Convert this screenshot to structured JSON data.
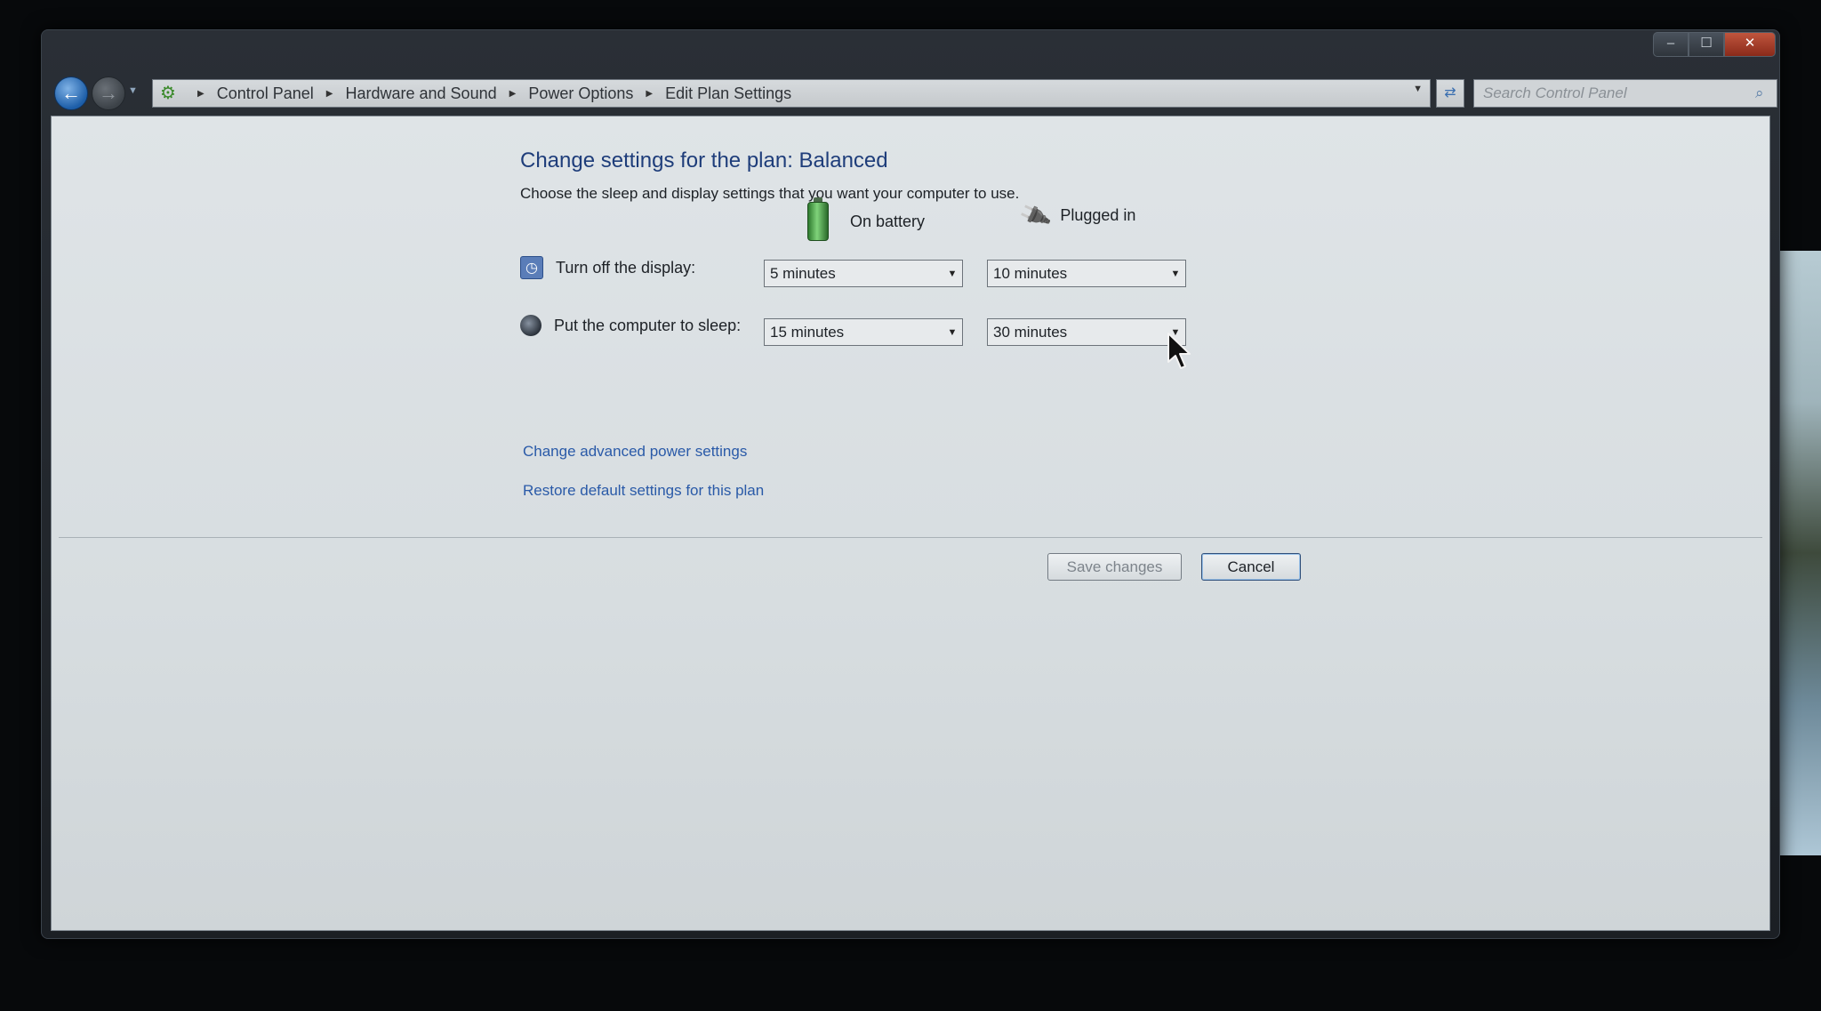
{
  "window": {
    "caption_buttons": {
      "minimize": "–",
      "maximize": "☐",
      "close": "✕"
    }
  },
  "navigation": {
    "back_icon": "back-arrow-icon",
    "forward_icon": "forward-arrow-icon",
    "breadcrumbs": [
      "Control Panel",
      "Hardware and Sound",
      "Power Options",
      "Edit Plan Settings"
    ],
    "search_placeholder": "Search Control Panel"
  },
  "page": {
    "title": "Change settings for the plan: Balanced",
    "subtitle": "Choose the sleep and display settings that you want your computer to use.",
    "columns": {
      "battery": "On battery",
      "plugged": "Plugged in"
    },
    "settings": {
      "display": {
        "label": "Turn off the display:",
        "on_battery": "5 minutes",
        "plugged_in": "10 minutes"
      },
      "sleep": {
        "label": "Put the computer to sleep:",
        "on_battery": "15 minutes",
        "plugged_in": "30 minutes"
      }
    },
    "links": {
      "advanced": "Change advanced power settings",
      "restore": "Restore default settings for this plan"
    },
    "buttons": {
      "save": "Save changes",
      "cancel": "Cancel"
    }
  },
  "colors": {
    "title": "#1e3d7a",
    "link": "#2a5aa8",
    "content_bg": "#dfe4e7"
  }
}
